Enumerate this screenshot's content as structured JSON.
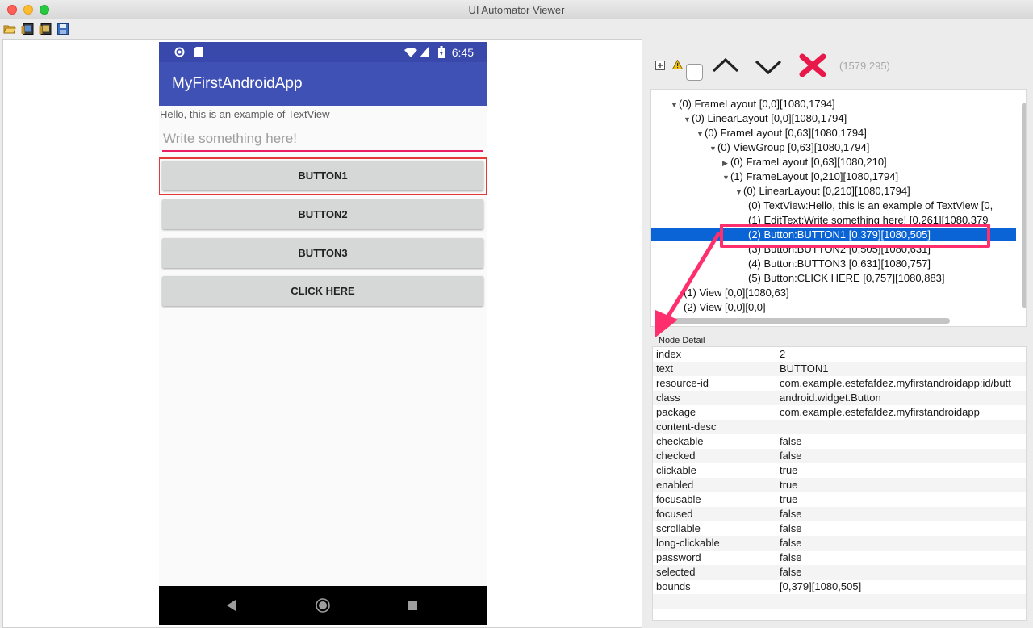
{
  "window": {
    "title": "UI Automator Viewer"
  },
  "toolbar": {
    "icons": [
      "open-folder-icon",
      "device-screenshot-icon",
      "device-screenshot-compressed-icon",
      "save-icon"
    ]
  },
  "device": {
    "status_time": "6:45",
    "app_title": "MyFirstAndroidApp",
    "hello_text": "Hello, this is an example of TextView",
    "edit_placeholder": "Write something here!",
    "buttons": [
      "BUTTON1",
      "BUTTON2",
      "BUTTON3",
      "CLICK HERE"
    ]
  },
  "inspector": {
    "coords": "(1579,295)",
    "tree": [
      {
        "label": "(0) FrameLayout [0,0][1080,1794]",
        "arrow": "down"
      },
      {
        "label": "(0) LinearLayout [0,0][1080,1794]",
        "arrow": "down"
      },
      {
        "label": "(0) FrameLayout [0,63][1080,1794]",
        "arrow": "down"
      },
      {
        "label": "(0) ViewGroup [0,63][1080,1794]",
        "arrow": "down"
      },
      {
        "label": "(0) FrameLayout [0,63][1080,210]",
        "arrow": "right"
      },
      {
        "label": "(1) FrameLayout [0,210][1080,1794]",
        "arrow": "down"
      },
      {
        "label": "(0) LinearLayout [0,210][1080,1794]",
        "arrow": "down"
      },
      {
        "label": "(0) TextView:Hello, this is an example of TextView [0,",
        "arrow": ""
      },
      {
        "label": "(1) EditText:Write something here! [0,261][1080,379",
        "arrow": ""
      },
      {
        "label": "(2) Button:BUTTON1 [0,379][1080,505]",
        "arrow": ""
      },
      {
        "label": "(3) Button:BUTTON2 [0,505][1080,631]",
        "arrow": ""
      },
      {
        "label": "(4) Button:BUTTON3 [0,631][1080,757]",
        "arrow": ""
      },
      {
        "label": "(5) Button:CLICK HERE [0,757][1080,883]",
        "arrow": ""
      },
      {
        "label": "(1) View [0,0][1080,63]",
        "arrow": ""
      },
      {
        "label": "(2) View [0,0][0,0]",
        "arrow": ""
      }
    ],
    "detail_title": "Node Detail",
    "details": [
      {
        "key": "index",
        "value": "2"
      },
      {
        "key": "text",
        "value": "BUTTON1"
      },
      {
        "key": "resource-id",
        "value": "com.example.estefafdez.myfirstandroidapp:id/butt"
      },
      {
        "key": "class",
        "value": "android.widget.Button"
      },
      {
        "key": "package",
        "value": "com.example.estefafdez.myfirstandroidapp"
      },
      {
        "key": "content-desc",
        "value": ""
      },
      {
        "key": "checkable",
        "value": "false"
      },
      {
        "key": "checked",
        "value": "false"
      },
      {
        "key": "clickable",
        "value": "true"
      },
      {
        "key": "enabled",
        "value": "true"
      },
      {
        "key": "focusable",
        "value": "true"
      },
      {
        "key": "focused",
        "value": "false"
      },
      {
        "key": "scrollable",
        "value": "false"
      },
      {
        "key": "long-clickable",
        "value": "false"
      },
      {
        "key": "password",
        "value": "false"
      },
      {
        "key": "selected",
        "value": "false"
      },
      {
        "key": "bounds",
        "value": "[0,379][1080,505]"
      }
    ]
  }
}
